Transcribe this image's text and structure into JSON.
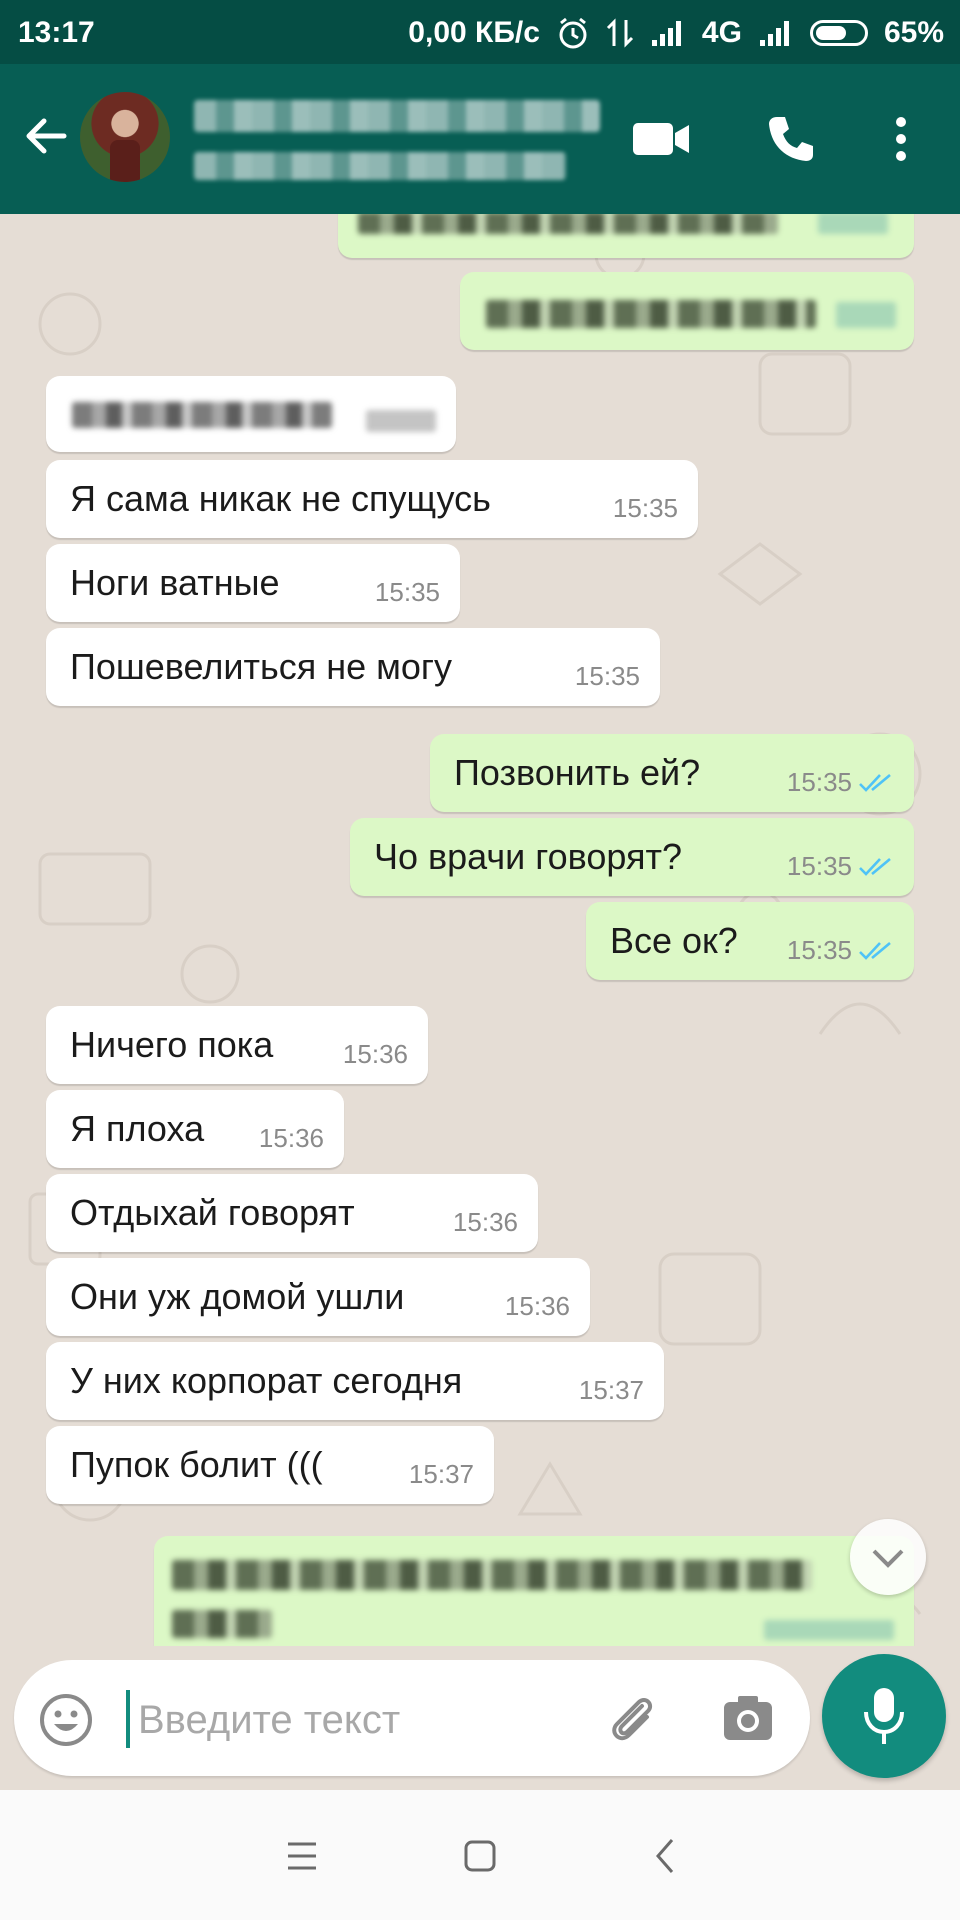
{
  "status_bar": {
    "time": "13:17",
    "network_speed": "0,00 КБ/с",
    "network_type": "4G",
    "battery": "65%",
    "battery_level": 0.65,
    "icons": [
      "alarm-icon",
      "data-arrows-icon",
      "signal-icon",
      "signal-icon",
      "battery-icon"
    ]
  },
  "app_bar": {
    "actions": [
      "video-call-icon",
      "voice-call-icon",
      "more-options-icon"
    ],
    "colors": {
      "header": "#075e54",
      "status": "#054d44"
    }
  },
  "messages": [
    {
      "direction": "in",
      "text": "Я сама никак не спущусь",
      "time": "15:35"
    },
    {
      "direction": "in",
      "text": "Ноги ватные",
      "time": "15:35"
    },
    {
      "direction": "in",
      "text": "Пошевелиться не могу",
      "time": "15:35"
    },
    {
      "direction": "out",
      "text": "Позвонить ей?",
      "time": "15:35",
      "status": "read"
    },
    {
      "direction": "out",
      "text": "Чо врачи говорят?",
      "time": "15:35",
      "status": "read"
    },
    {
      "direction": "out",
      "text": "Все ок?",
      "time": "15:35",
      "status": "read"
    },
    {
      "direction": "in",
      "text": "Ничего пока",
      "time": "15:36"
    },
    {
      "direction": "in",
      "text": "Я плоха",
      "time": "15:36"
    },
    {
      "direction": "in",
      "text": "Отдыхай говорят",
      "time": "15:36"
    },
    {
      "direction": "in",
      "text": "Они уж домой ушли",
      "time": "15:36"
    },
    {
      "direction": "in",
      "text": "У них корпорат сегодня",
      "time": "15:37"
    },
    {
      "direction": "in",
      "text": "Пупок болит (((",
      "time": "15:37"
    }
  ],
  "composer": {
    "placeholder": "Введите текст",
    "accent": "#128c7e"
  },
  "nav": [
    "menu-icon",
    "home-icon",
    "back-icon"
  ]
}
